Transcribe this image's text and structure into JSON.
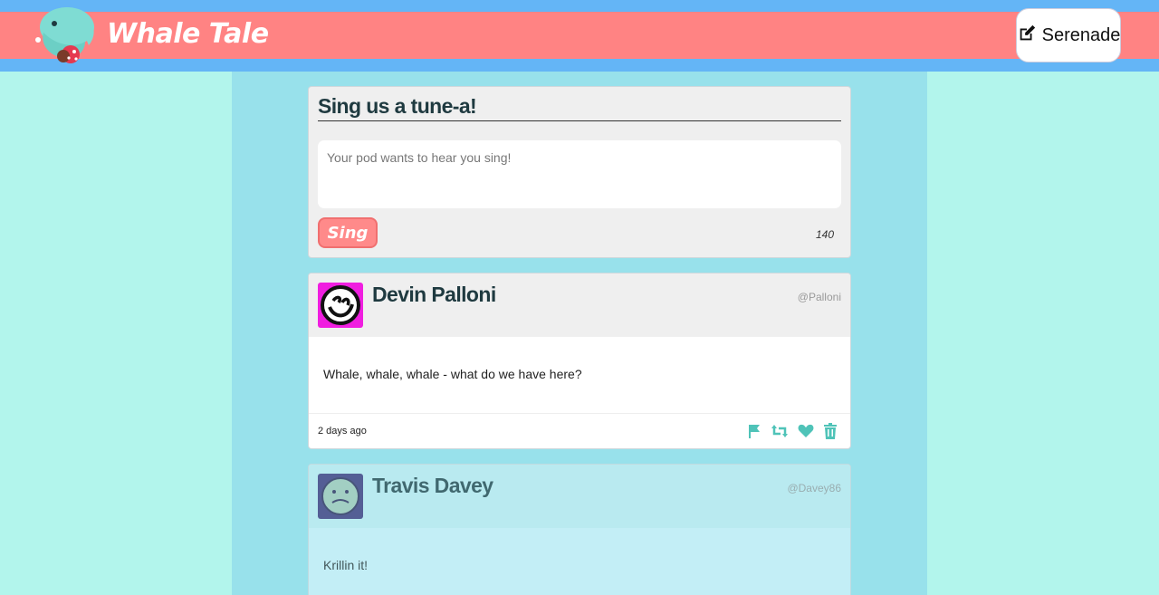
{
  "header": {
    "brand": "Whale Tale",
    "serenade_label": "Serenade"
  },
  "compose": {
    "title": "Sing us a tune-a!",
    "placeholder": "Your pod wants to hear you sing!",
    "sing_label": "Sing",
    "char_count": "140"
  },
  "posts": [
    {
      "name": "Devin Palloni",
      "handle": "@Palloni",
      "text": "Whale, whale, whale - what do we have here?",
      "time": "2 days ago"
    },
    {
      "name": "Travis Davey",
      "handle": "@Davey86",
      "text": "Krillin it!"
    }
  ],
  "colors": {
    "page_bg": "#b2f5ec",
    "header_blue": "#64b5f6",
    "header_band": "#ff8383",
    "column_bg": "#98e1eb",
    "action_icon": "#4fc3b8"
  },
  "icons": {
    "serenade": "edit-icon",
    "actions": [
      "flag-icon",
      "retweet-icon",
      "heart-icon",
      "trash-icon"
    ]
  }
}
